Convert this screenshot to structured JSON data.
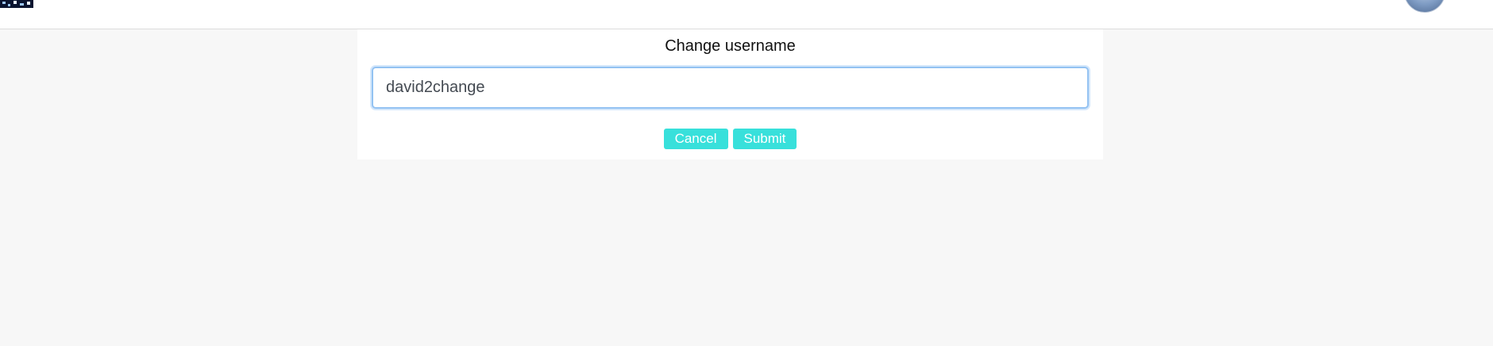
{
  "dialog": {
    "title": "Change username",
    "username_value": "david2change",
    "cancel_label": "Cancel",
    "submit_label": "Submit"
  },
  "colors": {
    "accent": "#38e0db",
    "background": "#f7f7f7",
    "focus_border": "#93c2f2"
  },
  "icons": {
    "logo": "logo-icon",
    "avatar": "user-avatar"
  }
}
